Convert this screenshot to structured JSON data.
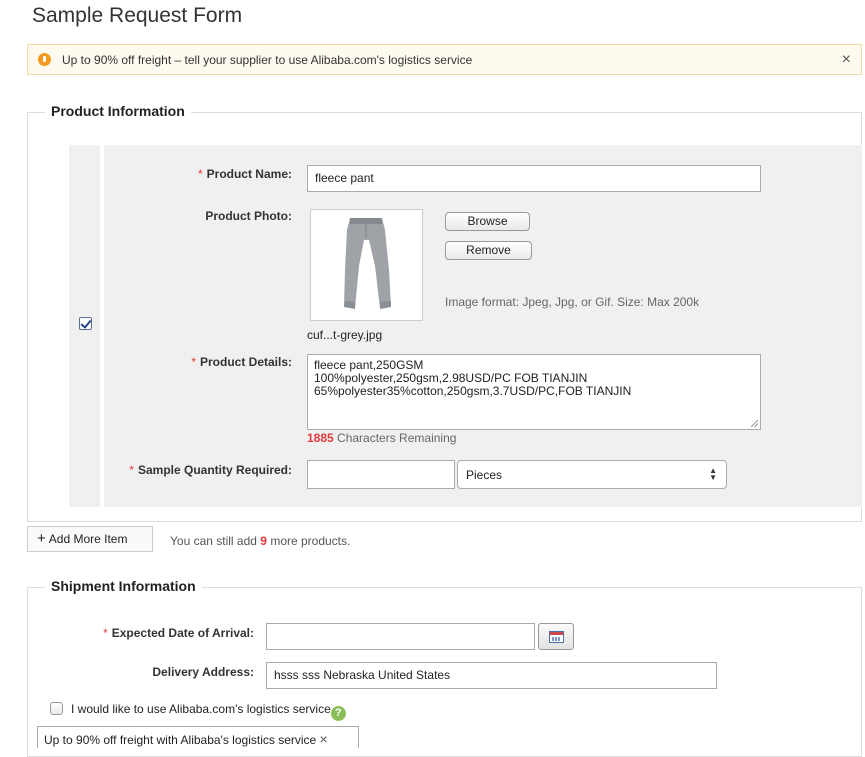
{
  "page_title": "Sample Request Form",
  "notice": {
    "text": "Up to 90% off freight – tell your supplier to use Alibaba.com's logistics service",
    "close": "×",
    "icon": "lightbulb-icon"
  },
  "product_section": {
    "legend": "Product Information",
    "item_checked": true,
    "required_mark": "*",
    "name_label": "Product Name:",
    "name_value": "fleece pant",
    "photo_label": "Product Photo:",
    "photo_filename": "cuf...t-grey.jpg",
    "browse_label": "Browse",
    "remove_label": "Remove",
    "photo_hint": "Image format: Jpeg, Jpg, or Gif. Size: Max 200k",
    "details_label": "Product Details:",
    "details_value": "fleece pant,250GSM\n100%polyester,250gsm,2.98USD/PC FOB TIANJIN\n65%polyester35%cotton,250gsm,3.7USD/PC,FOB TIANJIN",
    "chars_remaining_count": "1885",
    "chars_remaining_text": " Characters Remaining",
    "qty_label": "Sample Quantity Required:",
    "qty_value": "",
    "unit_selected": "Pieces"
  },
  "add_more": {
    "label": "Add More Item",
    "icon": "plus-icon",
    "hint_prefix": "You can still add ",
    "hint_count": "9",
    "hint_suffix": " more products."
  },
  "shipment_section": {
    "legend": "Shipment Information",
    "required_mark": "*",
    "arrival_label": "Expected Date of Arrival:",
    "arrival_value": "",
    "address_label": "Delivery Address:",
    "address_value": "hsss sss Nebraska United States",
    "logistics_checkbox_label": "I would like to use Alibaba.com's logistics service",
    "logistics_checked": false,
    "help_icon": "?",
    "tooltip_text": "Up to 90% off freight with Alibaba's logistics service",
    "tooltip_close": "×"
  },
  "colors": {
    "accent_red": "#e4393c",
    "notice_bg": "#fffaef",
    "product_bg": "#f0f0f0",
    "help_green": "#8cbf5a"
  }
}
